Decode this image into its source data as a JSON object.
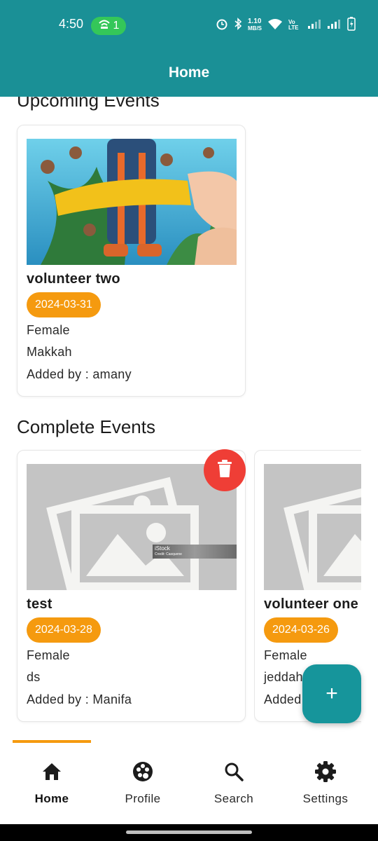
{
  "status_bar": {
    "time": "4:50",
    "hotspot_count": "1",
    "net_speed_value": "1.10",
    "net_speed_unit": "MB/S",
    "volte_label": "Vo LTE"
  },
  "app_bar": {
    "title": "Home"
  },
  "upcoming": {
    "title": "Upcoming Events",
    "events": [
      {
        "title": "volunteer two",
        "date": "2024-03-31",
        "gender": "Female",
        "city": "Makkah",
        "added_by": "Added by : amany"
      }
    ]
  },
  "complete": {
    "title": "Complete Events",
    "events": [
      {
        "title": "test",
        "date": "2024-03-28",
        "gender": "Female",
        "city": "ds",
        "added_by": "Added by : Manifa",
        "watermark": "iStock",
        "watermark_credit": "Credit: Casquene"
      },
      {
        "title": "volunteer one",
        "date": "2024-03-26",
        "gender": "Female",
        "city": "jeddah",
        "added_by": "Added by :"
      }
    ]
  },
  "fab": {
    "label": "+"
  },
  "bottom_nav": {
    "items": [
      {
        "label": "Home",
        "icon": "home-icon",
        "active": true
      },
      {
        "label": "Profile",
        "icon": "palette-icon",
        "active": false
      },
      {
        "label": "Search",
        "icon": "search-icon",
        "active": false
      },
      {
        "label": "Settings",
        "icon": "gear-icon",
        "active": false
      }
    ]
  },
  "colors": {
    "primary": "#1a9096",
    "accent_orange": "#f59a0f",
    "delete_red": "#ef3e36",
    "fab": "#16959b"
  }
}
